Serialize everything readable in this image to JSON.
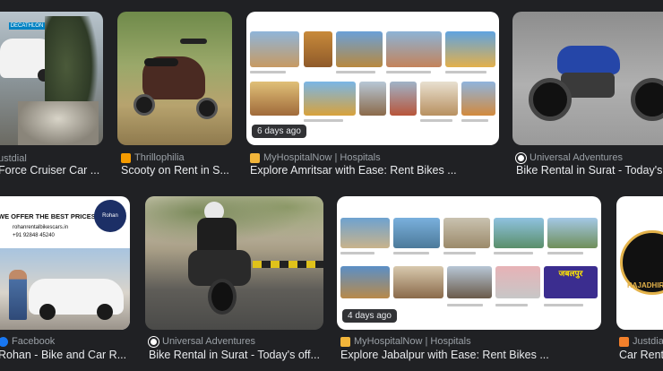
{
  "colors": {
    "background": "#202124",
    "source_text": "#9aa0a6",
    "title_text": "#e8eaed"
  },
  "results": [
    {
      "source": "Justdial",
      "source_shown": "ustdial",
      "title": "Force Cruiser Car ...",
      "icon": "justdial-icon",
      "icon_color": "#f3802b"
    },
    {
      "source": "Thrillophilia",
      "title": "Scooty on Rent in S...",
      "icon": "thrillophilia-icon",
      "icon_color": "#f59b00"
    },
    {
      "source": "MyHospitalNow | Hospitals",
      "title": "Explore Amritsar with Ease: Rent Bikes ...",
      "icon": "myhospitalnow-icon",
      "icon_color": "#f2b53a",
      "badge": "6 days ago"
    },
    {
      "source": "Universal Adventures",
      "title": "Bike Rental in Surat - Today's o",
      "icon": "universal-adventures-icon",
      "icon_color": "#ffffff"
    },
    {
      "source": "Facebook",
      "title": "Rohan - Bike and Car R...",
      "icon": "facebook-icon",
      "icon_color": "#1877f2"
    },
    {
      "source": "Universal Adventures",
      "title": "Bike Rental in Surat - Today's off...",
      "icon": "universal-adventures-icon",
      "icon_color": "#ffffff"
    },
    {
      "source": "MyHospitalNow | Hospitals",
      "title": "Explore Jabalpur with Ease: Rent Bikes ...",
      "icon": "myhospitalnow-icon",
      "icon_color": "#f2b53a",
      "badge": "4 days ago"
    },
    {
      "source": "Justdial",
      "title": "Car Renta",
      "icon": "justdial-icon",
      "icon_color": "#f3802b"
    }
  ],
  "image_text": {
    "decathlon": "DECATHLON",
    "rohan_tagline": "WE OFFER THE BEST PRICES",
    "rohan_site": "rohanrentalbikescars.in",
    "rohan_phone": "+91 92848 45240",
    "rohan_logo": "Rohan",
    "rajadhiraj": "RAJADHIR",
    "jabalpur_sign": "जबलपुर"
  }
}
